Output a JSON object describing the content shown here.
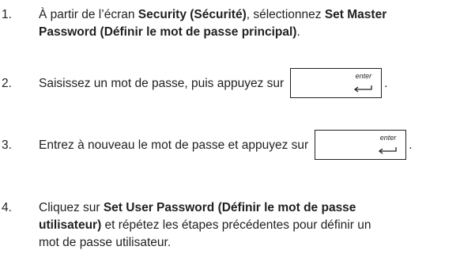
{
  "steps": [
    {
      "number": "1.",
      "line1_before": "À partir de l’écran ",
      "line1_bold1": "Security (Sécurité)",
      "line1_mid": ", sélectionnez ",
      "line1_bold2": "Set Master",
      "line2_bold": "Password (Définir le mot de passe principal)",
      "line2_after": "."
    },
    {
      "number": "2.",
      "text": "Saisissez un mot de passe, puis appuyez sur",
      "key_label": "enter",
      "key_icon": "enter-return-arrow-icon",
      "after": "."
    },
    {
      "number": "3.",
      "text": "Entrez à nouveau le mot de passe et appuyez sur",
      "key_label": "enter",
      "key_icon": "enter-return-arrow-icon",
      "after": "."
    },
    {
      "number": "4.",
      "line1_before": "Cliquez sur ",
      "line1_bold": "Set User Password (Définir le mot de passe",
      "line2_bold": "utilisateur)",
      "line2_after": " et répétez les étapes précédentes pour définir un",
      "line3": "mot de passe utilisateur."
    }
  ]
}
